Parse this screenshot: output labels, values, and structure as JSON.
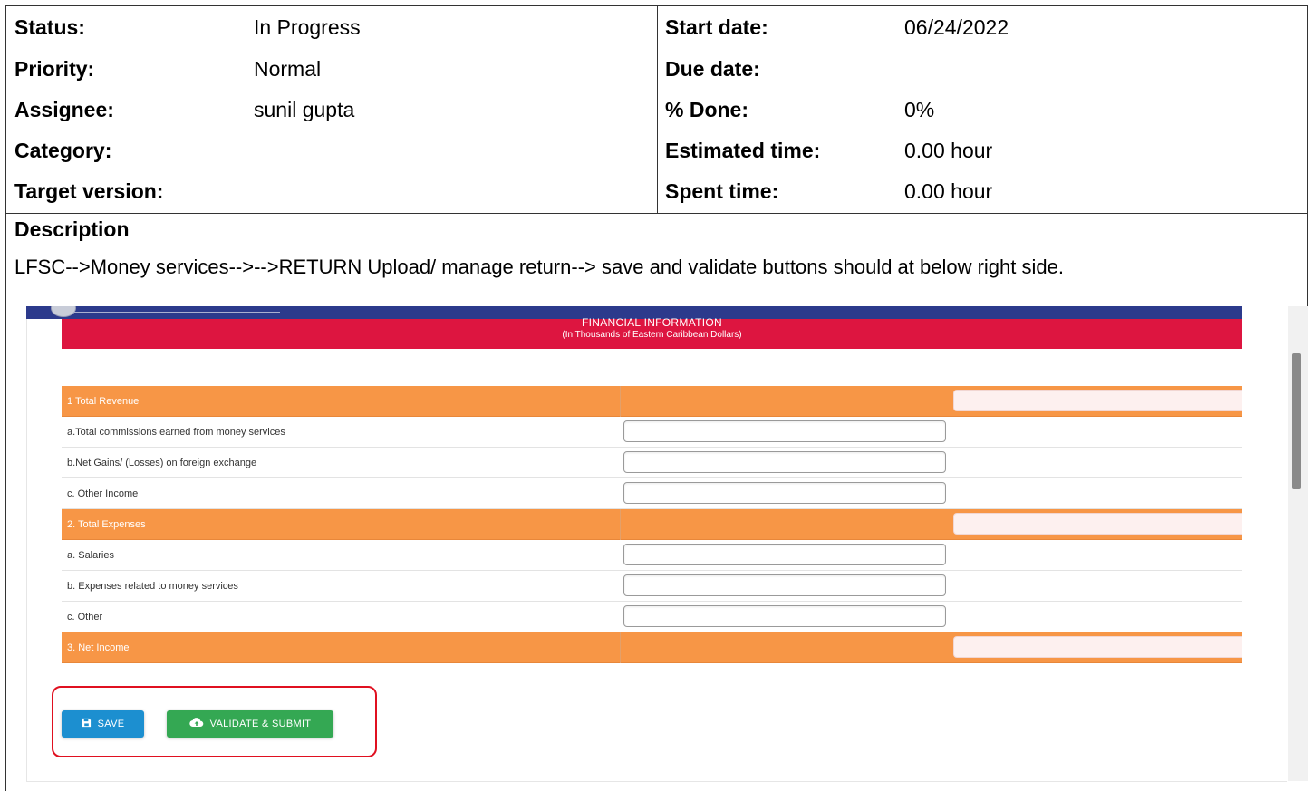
{
  "attributes_left": [
    {
      "label": "Status:",
      "value": "In Progress"
    },
    {
      "label": "Priority:",
      "value": "Normal"
    },
    {
      "label": "Assignee:",
      "value": "sunil gupta"
    },
    {
      "label": "Category:",
      "value": ""
    },
    {
      "label": "Target version:",
      "value": ""
    }
  ],
  "attributes_right": [
    {
      "label": "Start date:",
      "value": "06/24/2022"
    },
    {
      "label": "Due date:",
      "value": ""
    },
    {
      "label": "% Done:",
      "value": "0%"
    },
    {
      "label": "Estimated time:",
      "value": "0.00 hour"
    },
    {
      "label": "Spent time:",
      "value": "0.00 hour"
    }
  ],
  "description": {
    "title": "Description",
    "text": "LFSC-->Money services-->-->RETURN Upload/ manage return--> save and validate buttons should at below right side."
  },
  "screenshot": {
    "header_title": "FINANCIAL INFORMATION",
    "header_subtitle": "(In Thousands of Eastern Caribbean Dollars)",
    "rows": [
      {
        "label": "1 Total Revenue",
        "type": "section"
      },
      {
        "label": "a.Total commissions earned from money services",
        "type": "item"
      },
      {
        "label": "b.Net Gains/ (Losses) on foreign exchange",
        "type": "item"
      },
      {
        "label": "c. Other Income",
        "type": "item"
      },
      {
        "label": "2. Total Expenses",
        "type": "section"
      },
      {
        "label": "a. Salaries",
        "type": "item"
      },
      {
        "label": "b. Expenses related to money services",
        "type": "item"
      },
      {
        "label": "c. Other",
        "type": "item"
      },
      {
        "label": "3. Net Income",
        "type": "section"
      }
    ],
    "save_label": "SAVE",
    "validate_label": "VALIDATE & SUBMIT",
    "icons": {
      "save": "floppy-disk-icon",
      "validate": "cloud-upload-icon"
    },
    "colors": {
      "section": "#f79646",
      "header": "#dd1540",
      "save": "#1c8fd0",
      "validate": "#34a853",
      "highlight": "#e01020"
    }
  }
}
